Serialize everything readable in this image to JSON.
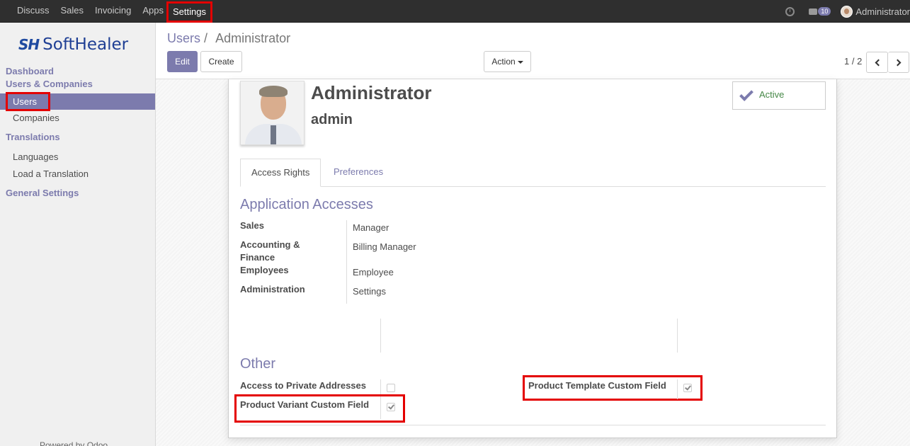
{
  "topbar": {
    "menu": [
      "Discuss",
      "Sales",
      "Invoicing",
      "Apps",
      "Settings"
    ],
    "active_menu": "Settings",
    "message_count": "10",
    "user": "Administrator"
  },
  "sidebar": {
    "logo_mark": "SH",
    "logo_text": "SoftHealer",
    "dashboard": "Dashboard",
    "users_companies": "Users & Companies",
    "users": "Users",
    "companies": "Companies",
    "translations": "Translations",
    "languages": "Languages",
    "load_translation": "Load a Translation",
    "general_settings": "General Settings",
    "footer": "Powered by Odoo"
  },
  "control": {
    "breadcrumb_parent": "Users",
    "breadcrumb_sep": "/",
    "breadcrumb_current": "Administrator",
    "edit": "Edit",
    "create": "Create",
    "action": "Action",
    "pager": "1 / 2"
  },
  "form": {
    "name": "Administrator",
    "login": "admin",
    "status": "Active",
    "tabs": [
      "Access Rights",
      "Preferences"
    ],
    "app_access_title": "Application Accesses",
    "access": [
      {
        "label": "Sales",
        "value": "Manager"
      },
      {
        "label": "Accounting & Finance",
        "value": "Billing Manager"
      },
      {
        "label": "Employees",
        "value": "Employee"
      },
      {
        "label": "Administration",
        "value": "Settings"
      }
    ],
    "other_title": "Other",
    "private_addresses": "Access to Private Addresses",
    "variant_field": "Product Variant Custom Field",
    "template_field": "Product Template Custom Field"
  },
  "colors": {
    "accent": "#7c7bad",
    "highlight": "#e40000",
    "topbar": "#2f2f2f"
  }
}
